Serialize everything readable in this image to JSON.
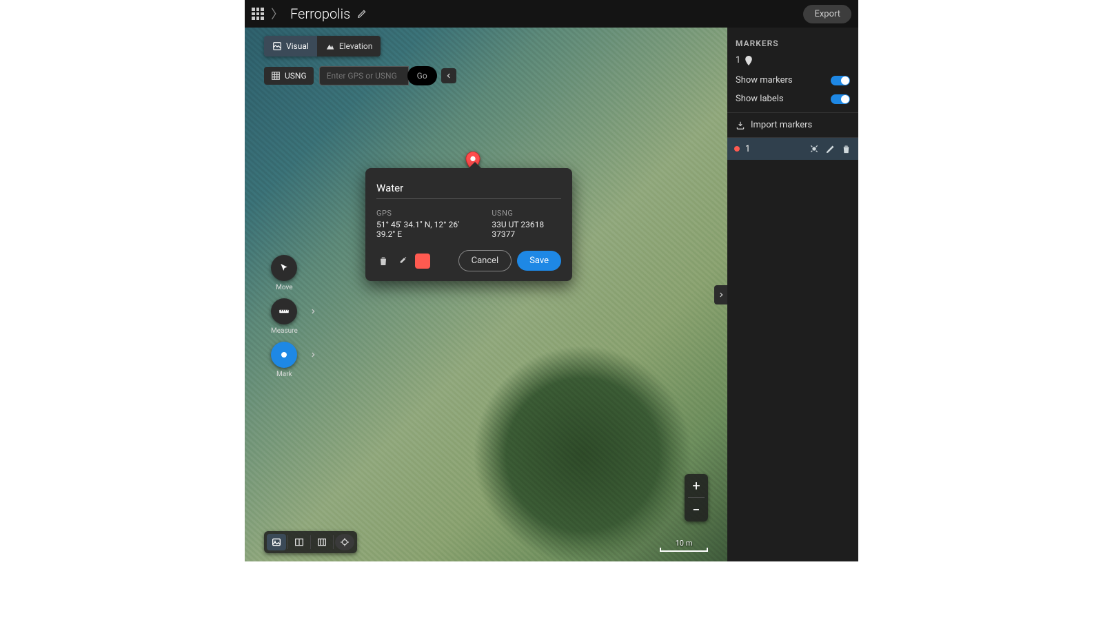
{
  "header": {
    "title": "Ferropolis",
    "export": "Export"
  },
  "tabs": {
    "visual": "Visual",
    "elevation": "Elevation"
  },
  "coord": {
    "usng": "USNG",
    "placeholder": "Enter GPS or USNG",
    "go": "Go"
  },
  "tools": {
    "move": "Move",
    "measure": "Measure",
    "mark": "Mark"
  },
  "scale": "10 m",
  "popup": {
    "name": "Water",
    "gps_label": "GPS",
    "gps_value": "51° 45' 34.1\" N, 12° 26' 39.2\" E",
    "usng_label": "USNG",
    "usng_value": "33U UT 23618 37377",
    "cancel": "Cancel",
    "save": "Save",
    "color": "#ff5a50"
  },
  "sidebar": {
    "title": "MARKERS",
    "count": "1",
    "show_markers": "Show markers",
    "show_labels": "Show labels",
    "import": "Import markers",
    "markers": [
      {
        "id": "1",
        "color": "#ff5a50"
      }
    ]
  }
}
